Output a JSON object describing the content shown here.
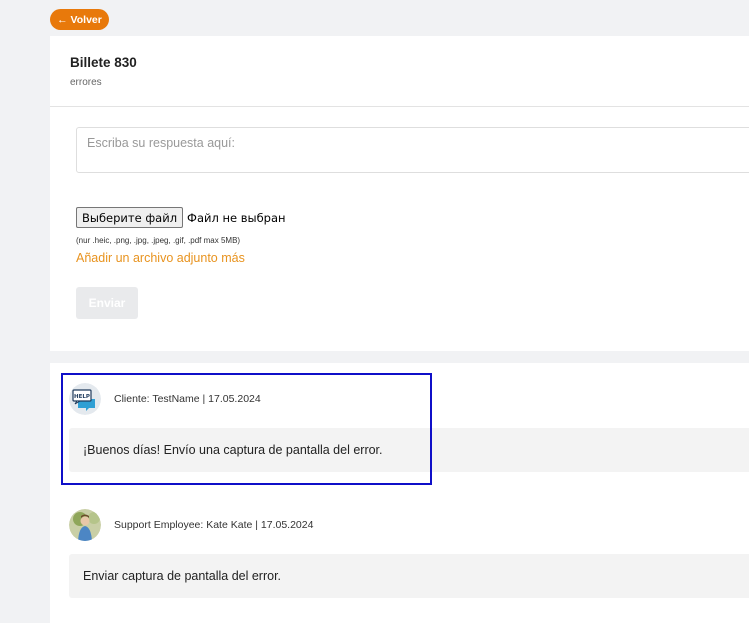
{
  "nav": {
    "back_label": "← Volver"
  },
  "ticket": {
    "title": "Billete 830",
    "subtitle": "errores"
  },
  "reply": {
    "placeholder": "Escriba su respuesta aquí:",
    "value": "",
    "file_button": "Выберите файл",
    "file_status": "Файл не выбран",
    "file_hint": "(nur .heic, .png, .jpg, .jpeg, .gif, .pdf max 5MB)",
    "add_attachment": "Añadir un archivo adjunto más",
    "send_label": "Enviar"
  },
  "messages": [
    {
      "author": "Cliente: TestName | 17.05.2024",
      "text": "¡Buenos días! Envío una captura de pantalla del error.",
      "avatar_icon": "help-chat-icon"
    },
    {
      "author": "Support Employee: Kate Kate | 17.05.2024",
      "text": "Enviar captura de pantalla del error.",
      "avatar_icon": "employee-photo-avatar"
    }
  ],
  "colors": {
    "accent": "#e8790b",
    "link": "#e8931f",
    "highlight_border": "#0f0fc8",
    "send_disabled": "#e9eaec"
  }
}
